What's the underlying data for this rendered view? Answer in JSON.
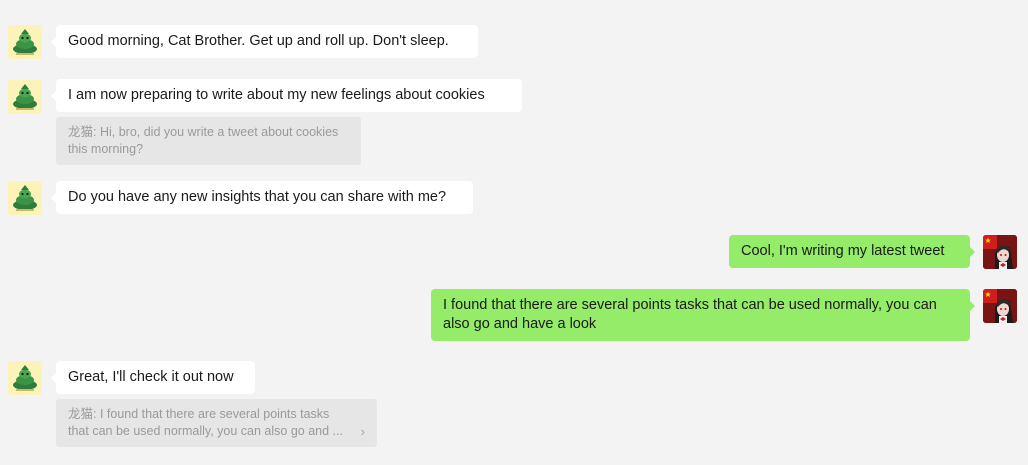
{
  "messages": [
    {
      "side": "left",
      "text": "Good morning, Cat Brother. Get up and roll up. Don't sleep."
    },
    {
      "side": "left",
      "text": "I am now preparing to write about my new feelings about cookies",
      "quote": {
        "sender": "龙猫:",
        "text": "Hi, bro, did you write a tweet about cookies this morning?"
      }
    },
    {
      "side": "left",
      "text": "Do you have any new insights that you can share with me?"
    },
    {
      "side": "right",
      "text": "Cool, I'm writing my latest tweet"
    },
    {
      "side": "right",
      "text": "I found that there are several points tasks that can be used normally, you can also go and have a look"
    },
    {
      "side": "left",
      "text": "Great, I'll check it out now",
      "quote": {
        "sender": "龙猫:",
        "text": "I found that there are several points tasks that can be used normally, you can also go and ...",
        "chevron": "›"
      }
    }
  ],
  "colors": {
    "background": "#f3f3f3",
    "incoming_bubble": "#ffffff",
    "outgoing_bubble": "#95ec69",
    "quote_bg": "#e6e6e6",
    "quote_text": "#9a9a9a"
  },
  "icons": {
    "contact_avatar": "green-totoro-avatar",
    "self_avatar": "anime-girl-flag-avatar"
  }
}
